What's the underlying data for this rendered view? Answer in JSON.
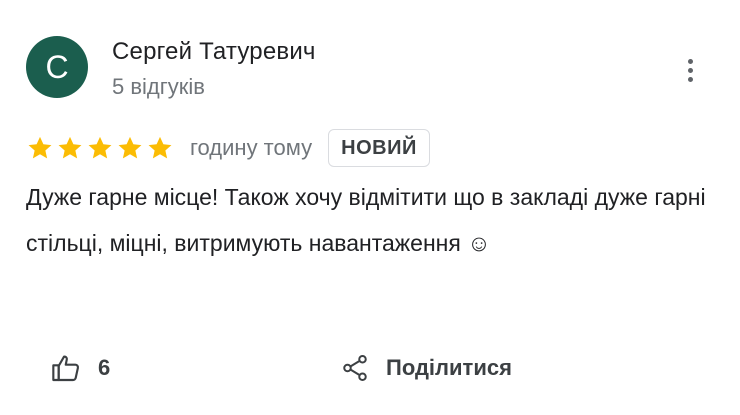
{
  "review": {
    "author": {
      "initial": "С",
      "name": "Сергей Татуревич",
      "meta": "5 відгуків",
      "avatar_color": "#1b5e4e"
    },
    "rating": 5,
    "star_color": "#fbbc04",
    "time_ago": "годину тому",
    "badge": "НОВИЙ",
    "text": "Дуже гарне місце! Також хочу відмітити що в закладі дуже гарні стільці, міцні, витримують навантаження ☺",
    "more_icon": "more-vert-icon"
  },
  "actions": {
    "like_icon": "thumb-up-icon",
    "like_count": "6",
    "share_icon": "share-icon",
    "share_label": "Поділитися"
  }
}
